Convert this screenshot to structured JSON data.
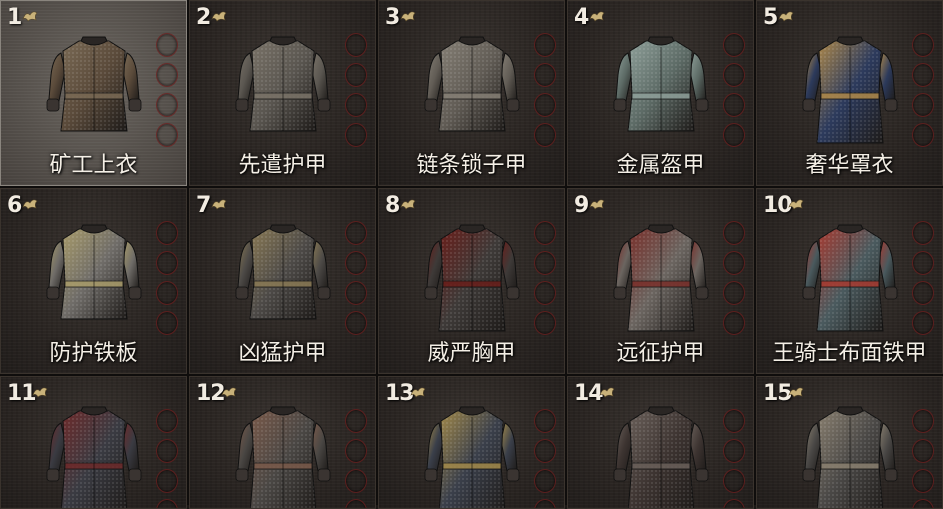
{
  "items": [
    {
      "num": "1",
      "name": "矿工上衣",
      "selected": true,
      "icon": "miner-shirt-icon",
      "color": "#5a4a3a",
      "accent": "#7a6a55"
    },
    {
      "num": "2",
      "name": "先遣护甲",
      "selected": false,
      "icon": "chainmail-tunic-icon",
      "color": "#5a5650",
      "accent": "#7a7368"
    },
    {
      "num": "3",
      "name": "链条锁子甲",
      "selected": false,
      "icon": "chainmail-hauberk-icon",
      "color": "#615c55",
      "accent": "#857f75"
    },
    {
      "num": "4",
      "name": "金属盔甲",
      "selected": false,
      "icon": "plate-cuirass-icon",
      "color": "#5d6b66",
      "accent": "#8fa09a"
    },
    {
      "num": "5",
      "name": "奢华罩衣",
      "selected": false,
      "icon": "blue-surcoat-icon",
      "color": "#2c3a5c",
      "accent": "#b08a4a"
    },
    {
      "num": "6",
      "name": "防护铁板",
      "selected": false,
      "icon": "iron-plate-icon",
      "color": "#6f6c68",
      "accent": "#a99c6a"
    },
    {
      "num": "7",
      "name": "凶猛护甲",
      "selected": false,
      "icon": "fierce-armor-icon",
      "color": "#4d4a47",
      "accent": "#8a7a55"
    },
    {
      "num": "8",
      "name": "威严胸甲",
      "selected": false,
      "icon": "majestic-breastplate-icon",
      "color": "#3e3a38",
      "accent": "#6a1e1a"
    },
    {
      "num": "9",
      "name": "远征护甲",
      "selected": false,
      "icon": "crusader-armor-icon",
      "color": "#6b6560",
      "accent": "#7a2f2a"
    },
    {
      "num": "10",
      "name": "王骑士布面铁甲",
      "selected": false,
      "icon": "royal-brigandine-icon",
      "color": "#4a5a5e",
      "accent": "#a83a30"
    },
    {
      "num": "11",
      "name": "",
      "selected": false,
      "icon": "dark-scale-armor-icon",
      "color": "#3a3b42",
      "accent": "#6e2a2a"
    },
    {
      "num": "12",
      "name": "",
      "selected": false,
      "icon": "scale-mail-icon",
      "color": "#4a4744",
      "accent": "#7a5a4a"
    },
    {
      "num": "13",
      "name": "",
      "selected": false,
      "icon": "gilded-scale-icon",
      "color": "#3a3f4a",
      "accent": "#a38a4a"
    },
    {
      "num": "14",
      "name": "",
      "selected": false,
      "icon": "leather-harness-icon",
      "color": "#3d3431",
      "accent": "#6a605a"
    },
    {
      "num": "15",
      "name": "",
      "selected": false,
      "icon": "spiked-plate-icon",
      "color": "#4a4846",
      "accent": "#8a8070"
    }
  ]
}
